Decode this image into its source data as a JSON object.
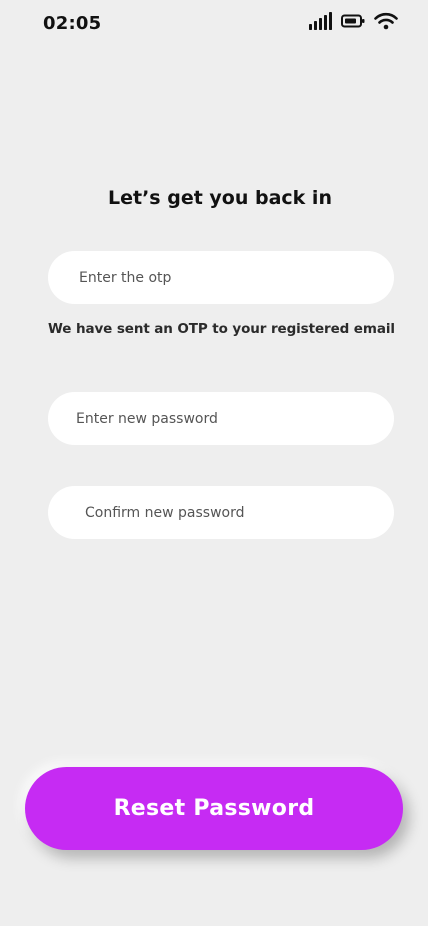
{
  "status_bar": {
    "time": "02:05",
    "icons": [
      "cellular-signal-icon",
      "battery-icon",
      "wifi-icon"
    ]
  },
  "page": {
    "title": "Let’s get you back in"
  },
  "form": {
    "otp": {
      "placeholder": "Enter the otp",
      "value": ""
    },
    "otp_hint": "We have sent an OTP to your registered email",
    "new_password": {
      "placeholder": "Enter new password",
      "value": ""
    },
    "confirm_password": {
      "placeholder": "Confirm new password",
      "value": ""
    }
  },
  "actions": {
    "reset_label": "Reset Password"
  },
  "colors": {
    "background": "#eeeeee",
    "field": "#ffffff",
    "accent": "#c62bf3"
  }
}
